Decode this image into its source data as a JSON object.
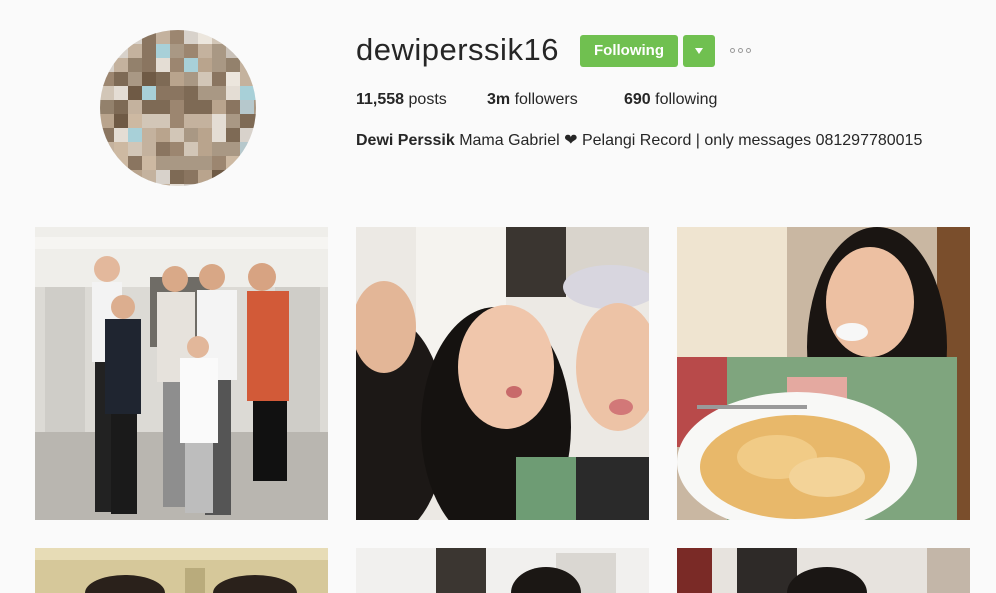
{
  "profile": {
    "username": "dewiperssik16",
    "following_label": "Following",
    "stats": {
      "posts_count": "11,558",
      "posts_label": "posts",
      "followers_count": "3m",
      "followers_label": "followers",
      "following_count": "690",
      "following_label": "following"
    },
    "bio": {
      "full_name": "Dewi Perssik",
      "text": "Mama Gabriel ❤ Pelangi Record | only messages 081297780015"
    }
  },
  "colors": {
    "follow_button": "#70c050",
    "background": "#fafafa",
    "text": "#262626"
  },
  "icons": {
    "dropdown": "chevron-down-icon",
    "more": "more-options-icon"
  },
  "posts": [
    {
      "description": "family group photo"
    },
    {
      "description": "selfie of three girls"
    },
    {
      "description": "woman with plate of food"
    },
    {
      "description": "post thumbnail"
    },
    {
      "description": "post thumbnail"
    },
    {
      "description": "post thumbnail"
    }
  ]
}
